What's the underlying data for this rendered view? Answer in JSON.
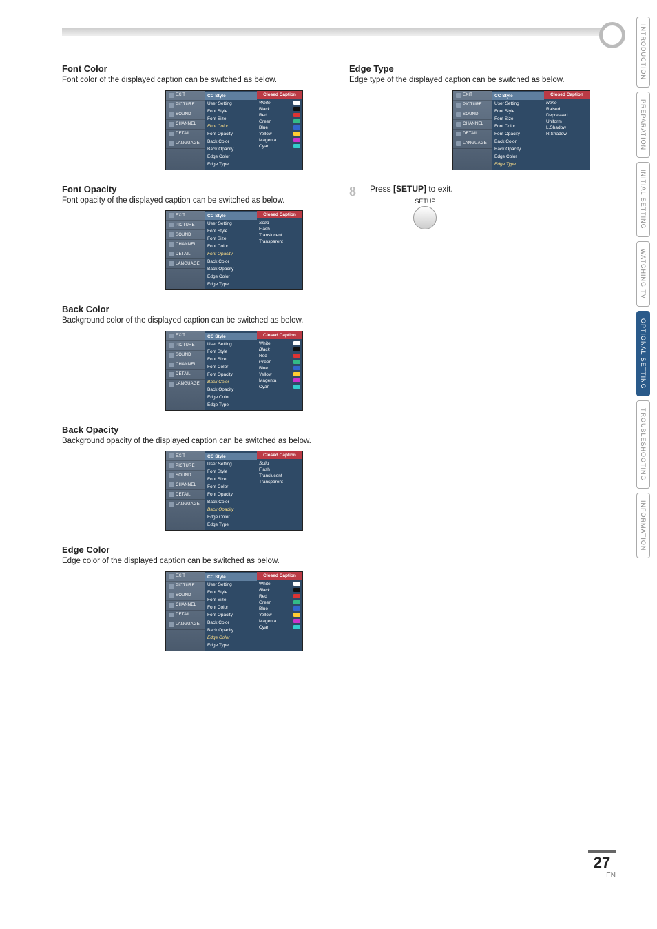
{
  "side_tabs": [
    "INTRODUCTION",
    "PREPARATION",
    "INITIAL SETTING",
    "WATCHING TV",
    "OPTIONAL SETTING",
    "TROUBLESHOOTING",
    "INFORMATION"
  ],
  "active_side_tab_index": 4,
  "osd": {
    "nav": [
      "EXIT",
      "PICTURE",
      "SOUND",
      "CHANNEL",
      "DETAIL",
      "LANGUAGE"
    ],
    "mid_head": "CC Style",
    "right_head": "Closed Caption",
    "mid_items": [
      "User Setting",
      "Font Style",
      "Font Size",
      "Font Color",
      "Font Opacity",
      "Back Color",
      "Back Opacity",
      "Edge Color",
      "Edge Type"
    ],
    "colors": [
      "White",
      "Black",
      "Red",
      "Green",
      "Blue",
      "Yellow",
      "Magenta",
      "Cyan"
    ],
    "opacity": [
      "Solid",
      "Flash",
      "Translucent",
      "Transparent"
    ],
    "edge_types": [
      "None",
      "Raised",
      "Depressed",
      "Uniform",
      "L.Shadow",
      "R.Shadow"
    ]
  },
  "sections": {
    "font_color": {
      "h": "Font Color",
      "p": "Font color of the displayed caption can be switched as below.",
      "highlight_index": 3,
      "right_mode": "colors",
      "right_sel": 0
    },
    "font_opacity": {
      "h": "Font Opacity",
      "p": "Font opacity of the displayed caption can be switched as below.",
      "highlight_index": 4,
      "right_mode": "opacity",
      "right_sel": 0
    },
    "back_color": {
      "h": "Back Color",
      "p": "Background color of the displayed caption can be switched as below.",
      "highlight_index": 5,
      "right_mode": "colors",
      "right_sel": 1
    },
    "back_opacity": {
      "h": "Back Opacity",
      "p": "Background opacity of the displayed caption can be switched as below.",
      "highlight_index": 6,
      "right_mode": "opacity",
      "right_sel": 0
    },
    "edge_color": {
      "h": "Edge Color",
      "p": "Edge color of the displayed caption can be switched as below.",
      "highlight_index": 7,
      "right_mode": "colors",
      "right_sel": 1
    },
    "edge_type": {
      "h": "Edge Type",
      "p": "Edge type of the displayed caption can be switched as below.",
      "highlight_index": 8,
      "right_mode": "edge_types",
      "right_sel": 0
    }
  },
  "step8": {
    "num": "8",
    "text_pre": "Press ",
    "text_bold": "[SETUP]",
    "text_post": " to exit.",
    "btn_label": "SETUP"
  },
  "page_number": "27",
  "lang_code": "EN"
}
